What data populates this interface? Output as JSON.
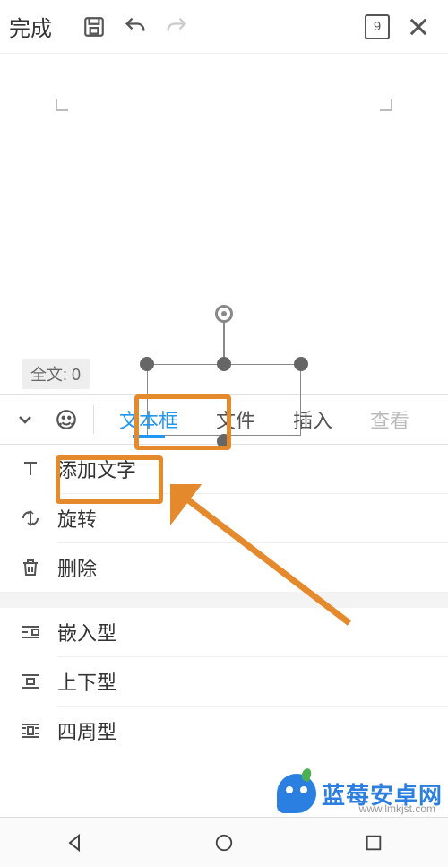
{
  "topbar": {
    "done": "完成",
    "page_number": "9"
  },
  "canvas": {
    "word_count_label": "全文: 0"
  },
  "tabs": {
    "textbox": "文本框",
    "file": "文件",
    "insert": "插入",
    "view": "查看"
  },
  "menu": {
    "add_text": "添加文字",
    "rotate": "旋转",
    "delete": "删除",
    "wrap_inline": "嵌入型",
    "wrap_topbottom": "上下型",
    "wrap_around": "四周型"
  },
  "watermark": {
    "brand": "蓝莓安卓网",
    "url": "www.lmkjst.com"
  },
  "colors": {
    "accent": "#2196F3",
    "highlight": "#E58A2C",
    "brand": "#2B7FE0"
  }
}
